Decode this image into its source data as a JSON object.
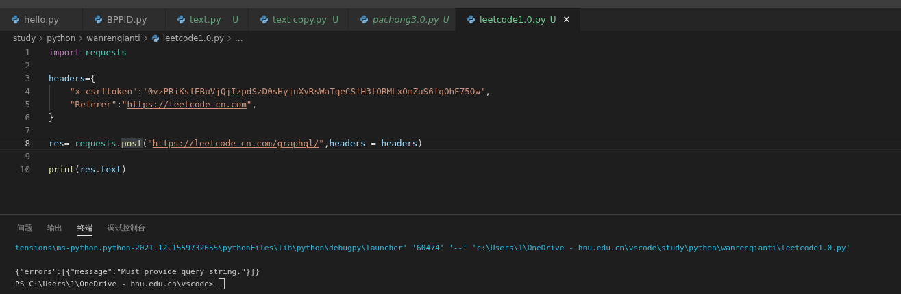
{
  "tabs": [
    {
      "label": "hello.py",
      "untracked": false,
      "preview": false,
      "selected": false
    },
    {
      "label": "BPPID.py",
      "untracked": false,
      "preview": false,
      "selected": false
    },
    {
      "label": "text.py",
      "untracked": true,
      "preview": false,
      "badge": "U",
      "selected": false
    },
    {
      "label": "text copy.py",
      "untracked": true,
      "preview": false,
      "badge": "U",
      "selected": false
    },
    {
      "label": "pachong3.0.py",
      "untracked": true,
      "preview": true,
      "badge": "U",
      "selected": false
    },
    {
      "label": "leetcode1.0.py",
      "untracked": true,
      "preview": false,
      "badge": "U",
      "close": "✕",
      "selected": true
    }
  ],
  "breadcrumb": [
    "study",
    "python",
    "wanrenqianti",
    "leetcode1.0.py",
    "..."
  ],
  "code": [
    {
      "number": "1",
      "current": false,
      "tokens": [
        {
          "kind": "kw",
          "text": "import "
        },
        {
          "kind": "mod",
          "text": "requests"
        }
      ]
    },
    {
      "number": "2",
      "current": false
    },
    {
      "number": "3",
      "current": false,
      "tokens": [
        {
          "kind": "var",
          "text": "headers"
        },
        {
          "kind": "plain",
          "text": "={"
        }
      ]
    },
    {
      "number": "4",
      "current": false,
      "indent": true,
      "tokens": [
        {
          "kind": "str",
          "text": "\"x-csrftoken\""
        },
        {
          "kind": "plain",
          "text": ":"
        },
        {
          "kind": "str",
          "text": "'0vzPRiKsfEBuVjQjIzpdSzD0sHyjnXvRsWaTqeCSfH3tORMLxOmZuS6fqOhF75Ow'"
        },
        {
          "kind": "plain",
          "text": ","
        }
      ]
    },
    {
      "number": "5",
      "current": false,
      "indent": true,
      "tokens": [
        {
          "kind": "str",
          "text": "\"Referer\""
        },
        {
          "kind": "plain",
          "text": ":"
        },
        {
          "kind": "str",
          "text": "\""
        },
        {
          "kind": "url",
          "text": "https://leetcode-cn.com"
        },
        {
          "kind": "str",
          "text": "\""
        },
        {
          "kind": "plain",
          "text": ","
        }
      ]
    },
    {
      "number": "6",
      "current": false,
      "tokens": [
        {
          "kind": "plain",
          "text": "}"
        }
      ]
    },
    {
      "number": "7",
      "current": false
    },
    {
      "number": "8",
      "current": true,
      "tokens": [
        {
          "kind": "var",
          "text": "res"
        },
        {
          "kind": "plain",
          "text": "= "
        },
        {
          "kind": "mod",
          "text": "requests"
        },
        {
          "kind": "plain",
          "text": "."
        },
        {
          "kind": "fnhl",
          "text": "post"
        },
        {
          "kind": "plain",
          "text": "("
        },
        {
          "kind": "str",
          "text": "\""
        },
        {
          "kind": "url",
          "text": "https://leetcode-cn.com/graphql/"
        },
        {
          "kind": "str",
          "text": "\""
        },
        {
          "kind": "plain",
          "text": ","
        },
        {
          "kind": "var",
          "text": "headers"
        },
        {
          "kind": "plain",
          "text": " = "
        },
        {
          "kind": "var",
          "text": "headers"
        },
        {
          "kind": "plain",
          "text": ")"
        }
      ]
    },
    {
      "number": "9",
      "current": false
    },
    {
      "number": "10",
      "current": false,
      "tokens": [
        {
          "kind": "fn",
          "text": "print"
        },
        {
          "kind": "plain",
          "text": "("
        },
        {
          "kind": "var",
          "text": "res"
        },
        {
          "kind": "plain",
          "text": "."
        },
        {
          "kind": "var",
          "text": "text"
        },
        {
          "kind": "plain",
          "text": ")"
        }
      ]
    }
  ],
  "panel_tabs": [
    {
      "label": "问题",
      "selected": false
    },
    {
      "label": "输出",
      "selected": false
    },
    {
      "label": "终端",
      "selected": true
    },
    {
      "label": "调试控制台",
      "selected": false
    }
  ],
  "terminal": [
    {
      "kind": "command",
      "text": "tensions\\ms-python.python-2021.12.1559732655\\pythonFiles\\lib\\python\\debugpy\\launcher' '60474' '--' 'c:\\Users\\1\\OneDrive - hnu.edu.cn\\vscode\\study\\python\\wanrenqianti\\leetcode1.0.py'"
    },
    {
      "kind": "blank"
    },
    {
      "kind": "output",
      "text": "{\"errors\":[{\"message\":\"Must provide query string.\"}]}"
    },
    {
      "kind": "prompt",
      "text": "PS C:\\Users\\1\\OneDrive - hnu.edu.cn\\vscode>"
    }
  ]
}
